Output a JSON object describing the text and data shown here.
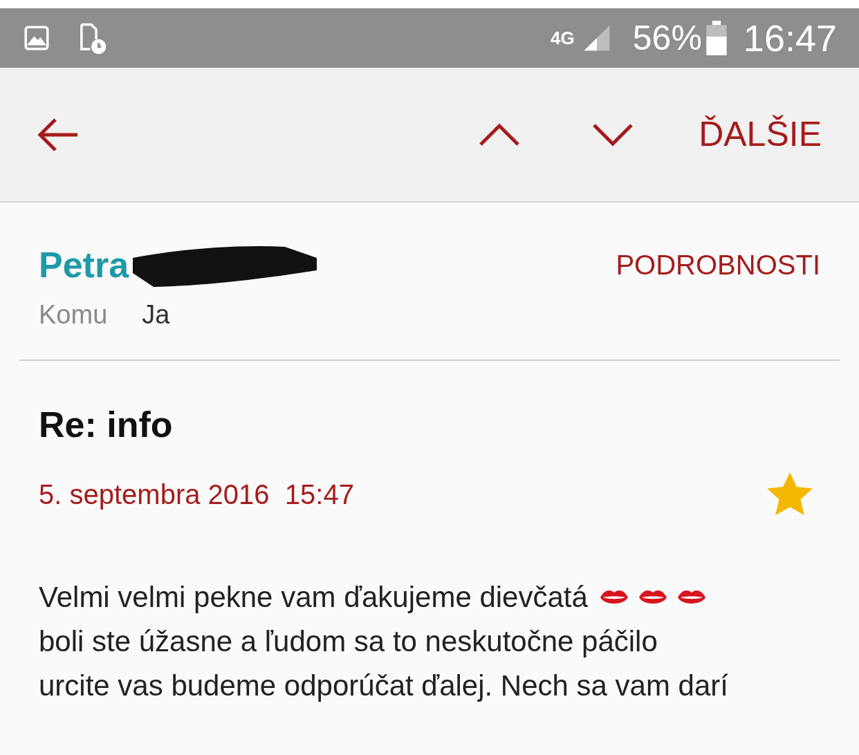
{
  "status_bar": {
    "network": "4G",
    "battery": "56%",
    "time": "16:47"
  },
  "toolbar": {
    "more": "ĎALŠIE"
  },
  "message": {
    "sender": "Petra",
    "sender_redacted": true,
    "details": "PODROBNOSTI",
    "to_label": "Komu",
    "to": "Ja",
    "subject": "Re: info",
    "date": "5. septembra 2016  15:47",
    "starred": true,
    "body_lines": [
      "Velmi velmi pekne vam ďakujeme dievčatá",
      "boli ste úžasne a ľudom sa to neskutočne páčilo",
      "urcite vas budeme odporúčat ďalej. Nech sa vam darí"
    ],
    "emojis": [
      {
        "kind": "lips"
      },
      {
        "kind": "lips"
      },
      {
        "kind": "lips"
      }
    ]
  }
}
